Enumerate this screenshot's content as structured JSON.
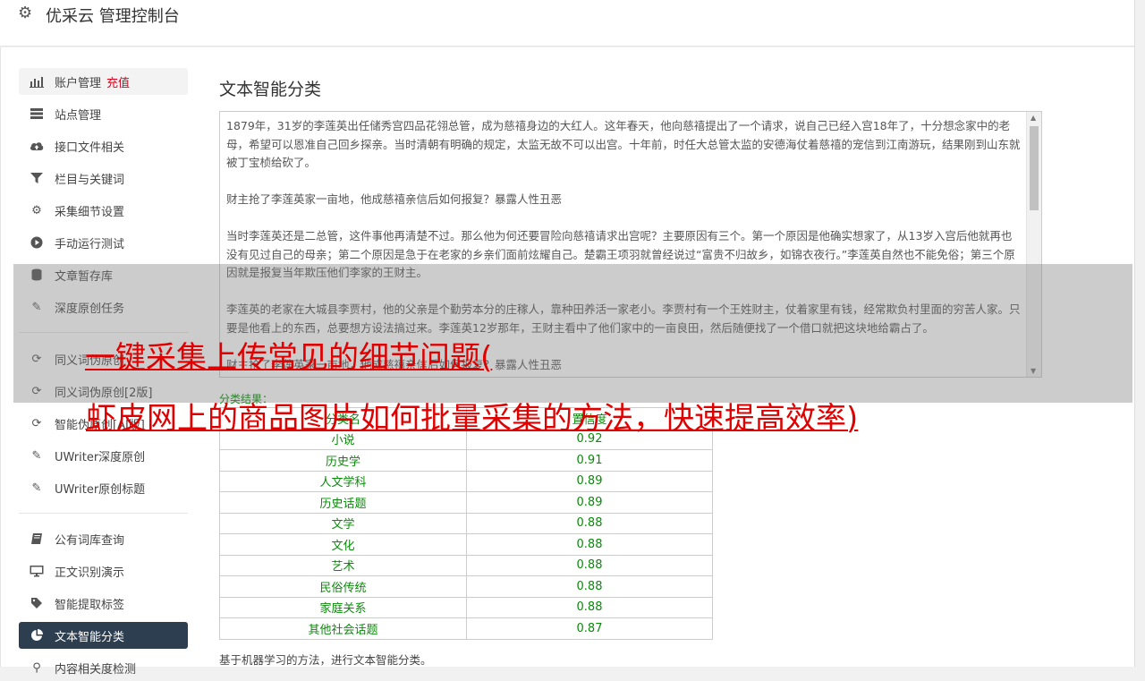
{
  "app": {
    "title": "优采云 管理控制台"
  },
  "sidebar": {
    "items": [
      {
        "label": "账户管理",
        "badge": "充值",
        "icon": "bar-chart-icon"
      },
      {
        "label": "站点管理",
        "icon": "server-icon"
      },
      {
        "label": "接口文件相关",
        "icon": "cloud-upload-icon"
      },
      {
        "label": "栏目与关键词",
        "icon": "filter-icon"
      },
      {
        "label": "采集细节设置",
        "icon": "gears-icon"
      },
      {
        "label": "手动运行测试",
        "icon": "play-circle-icon"
      },
      {
        "label": "文章暂存库",
        "icon": "database-icon"
      },
      {
        "label": "深度原创任务",
        "icon": "edit-icon"
      },
      {
        "label": "同义词伪原创",
        "icon": "refresh-icon"
      },
      {
        "label": "同义词伪原创[2版]",
        "icon": "refresh-icon"
      },
      {
        "label": "智能伪原创[AI版]",
        "icon": "refresh-icon"
      },
      {
        "label": "UWriter深度原创",
        "icon": "edit-icon"
      },
      {
        "label": "UWriter原创标题",
        "icon": "edit-icon"
      },
      {
        "label": "公有词库查询",
        "icon": "book-icon"
      },
      {
        "label": "正文识别演示",
        "icon": "monitor-icon"
      },
      {
        "label": "智能提取标签",
        "icon": "tag-icon"
      },
      {
        "label": "文本智能分类",
        "icon": "pie-chart-icon"
      },
      {
        "label": "内容相关度检测",
        "icon": "search-icon"
      }
    ]
  },
  "main": {
    "title": "文本智能分类",
    "text_paragraphs": [
      "1879年，31岁的李莲英出任储秀宫四品花翎总管，成为慈禧身边的大红人。这年春天，他向慈禧提出了一个请求，说自己已经入宫18年了，十分想念家中的老母，希望可以恩准自己回乡探亲。当时清朝有明确的规定，太监无故不可以出宫。十年前，时任大总管太监的安德海仗着慈禧的宠信到江南游玩，结果刚到山东就被丁宝桢给砍了。",
      "财主抢了李莲英家一亩地，他成慈禧亲信后如何报复？暴露人性丑恶",
      "当时李莲英还是二总管，这件事他再清楚不过。那么他为何还要冒险向慈禧请求出宫呢？主要原因有三个。第一个原因是他确实想家了，从13岁入宫后他就再也没有见过自己的母亲；第二个原因是急于在老家的乡亲们面前炫耀自己。楚霸王项羽就曾经说过“富贵不归故乡，如锦衣夜行。”李莲英自然也不能免俗；第三个原因就是报复当年欺压他们李家的王财主。",
      "李莲英的老家在大城县李贾村，他的父亲是个勤劳本分的庄稼人，靠种田养活一家老小。李贾村有一个王姓财主，仗着家里有钱，经常欺负村里面的穷苦人家。只要是他看上的东西，总要想方设法搞过来。李莲英12岁那年，王财主看中了他们家中的一亩良田，然后随便找了一个借口就把这块地给霸占了。",
      "财主抢了李莲英家一亩地，他成慈禧亲信后如何报复？暴露人性丑恶"
    ],
    "result_label": "分类结果：",
    "table": {
      "headers": [
        "分类名",
        "置信度"
      ],
      "rows": [
        [
          "小说",
          "0.92"
        ],
        [
          "历史学",
          "0.91"
        ],
        [
          "人文学科",
          "0.89"
        ],
        [
          "历史话题",
          "0.89"
        ],
        [
          "文学",
          "0.88"
        ],
        [
          "文化",
          "0.88"
        ],
        [
          "艺术",
          "0.88"
        ],
        [
          "民俗传统",
          "0.88"
        ],
        [
          "家庭关系",
          "0.88"
        ],
        [
          "其他社会话题",
          "0.87"
        ]
      ]
    },
    "footer_note": "基于机器学习的方法，进行文本智能分类。"
  },
  "overlay": {
    "line1": "一键采集上传常见的细节问题(",
    "line2": "虾皮网上的商品图片如何批量采集的方法，快速提高效率)"
  },
  "colors": {
    "active_bg": "#2d3e50",
    "accent_red": "#e0001b",
    "result_green": "#0a8a0a",
    "overlay_red": "#e00000"
  }
}
